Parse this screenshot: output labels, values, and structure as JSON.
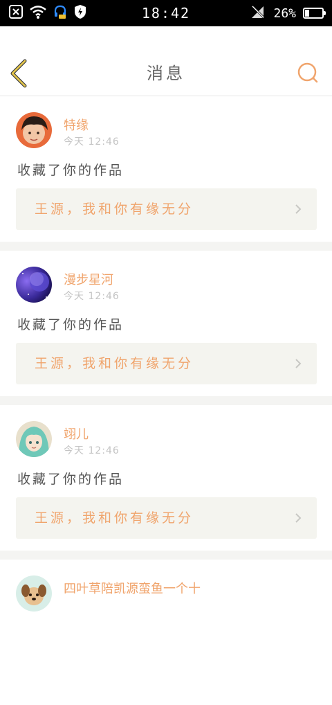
{
  "status_bar": {
    "time": "18:42",
    "battery_percent": "26%",
    "battery_level": 0.26,
    "icons_left": [
      "close-box-icon",
      "wifi-icon",
      "headset-notification-icon",
      "shield-bolt-icon"
    ],
    "icons_right": [
      "signal-off-icon",
      "battery-icon"
    ]
  },
  "header": {
    "title": "消息",
    "back_icon": "chevron-left-icon",
    "search_icon": "search-icon"
  },
  "messages": [
    {
      "user": "特缘",
      "time": "今天 12:46",
      "action": "收藏了你的作品",
      "work_title": "王源，我和你有缘无分"
    },
    {
      "user": "漫步星河",
      "time": "今天 12:46",
      "action": "收藏了你的作品",
      "work_title": "王源，我和你有缘无分"
    },
    {
      "user": "翊儿",
      "time": "今天 12:46",
      "action": "收藏了你的作品",
      "work_title": "王源，我和你有缘无分"
    },
    {
      "user": "四叶草陪凯源蛮鱼一个十"
    }
  ],
  "colors": {
    "accent": "#f0a46c",
    "back_arrow": "#e8c94a",
    "page_gap": "#f4f4f2",
    "work_box": "#f4f4ef"
  }
}
